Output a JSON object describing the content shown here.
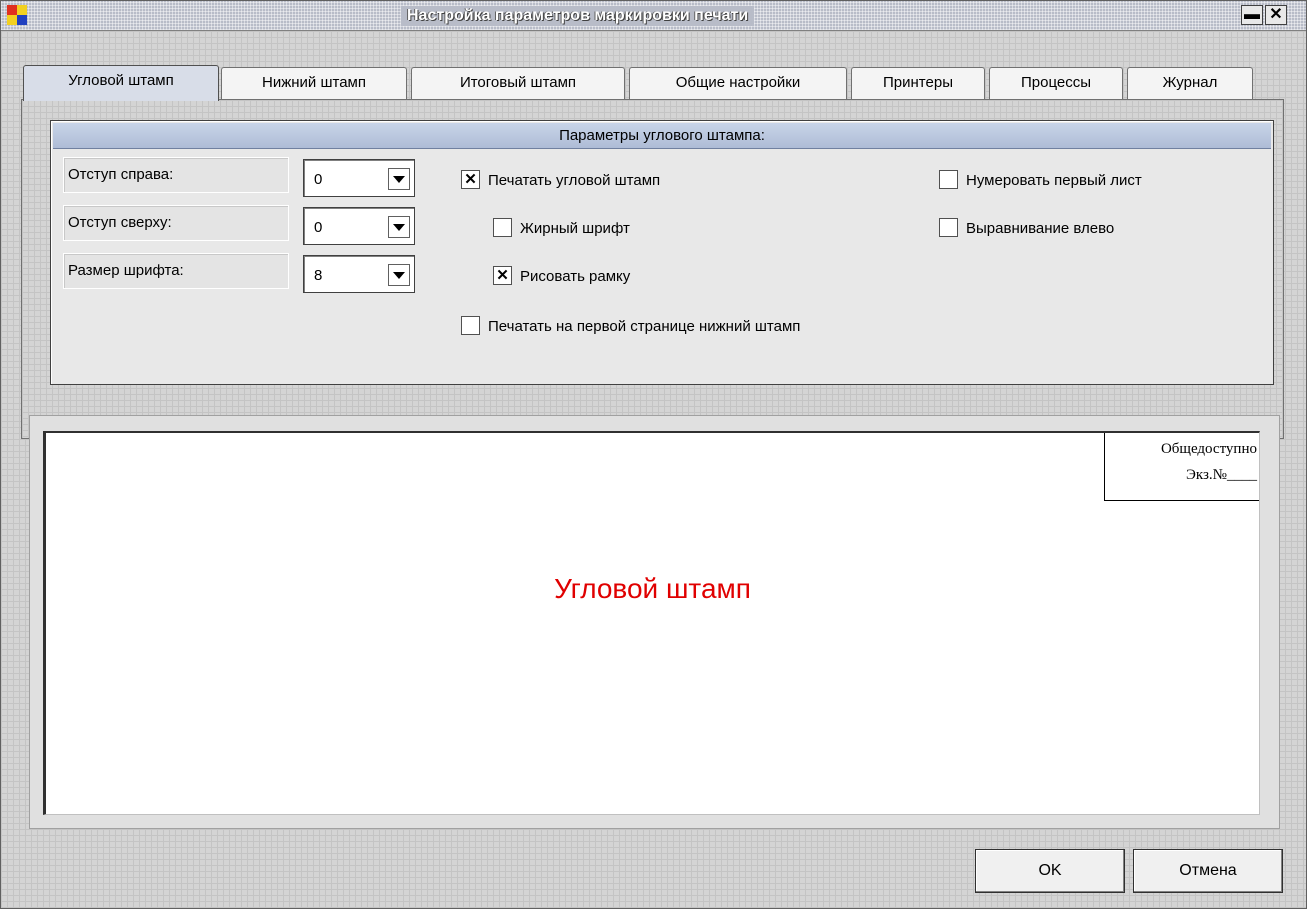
{
  "window": {
    "title": "Настройка параметров маркировки печати",
    "minimize_glyph": "▬",
    "close_glyph": "✕"
  },
  "tabs": [
    {
      "label": "Угловой штамп",
      "active": true
    },
    {
      "label": "Нижний штамп",
      "active": false
    },
    {
      "label": "Итоговый штамп",
      "active": false
    },
    {
      "label": "Общие настройки",
      "active": false
    },
    {
      "label": "Принтеры",
      "active": false
    },
    {
      "label": "Процессы",
      "active": false
    },
    {
      "label": "Журнал",
      "active": false
    }
  ],
  "group": {
    "header": "Параметры углового штампа:",
    "fields": [
      {
        "label": "Отступ справа:",
        "value": "0"
      },
      {
        "label": "Отступ сверху:",
        "value": "0"
      },
      {
        "label": "Размер шрифта:",
        "value": "8"
      }
    ],
    "checks": [
      {
        "label": "Печатать угловой штамп",
        "checked": true
      },
      {
        "label": "Жирный шрифт",
        "checked": false
      },
      {
        "label": "Рисовать рамку",
        "checked": true
      },
      {
        "label": "Печатать на первой странице нижний штамп",
        "checked": false
      },
      {
        "label": "Нумеровать первый лист",
        "checked": false
      },
      {
        "label": "Выравнивание влево",
        "checked": false
      }
    ]
  },
  "preview": {
    "stamp_line1": "Общедоступно",
    "stamp_line2": "Экз.№____",
    "title": "Угловой штамп"
  },
  "buttons": {
    "ok": "OK",
    "cancel": "Отмена"
  },
  "colors": {
    "preview_title": "#e00000",
    "group_header": "#aebcd6"
  }
}
